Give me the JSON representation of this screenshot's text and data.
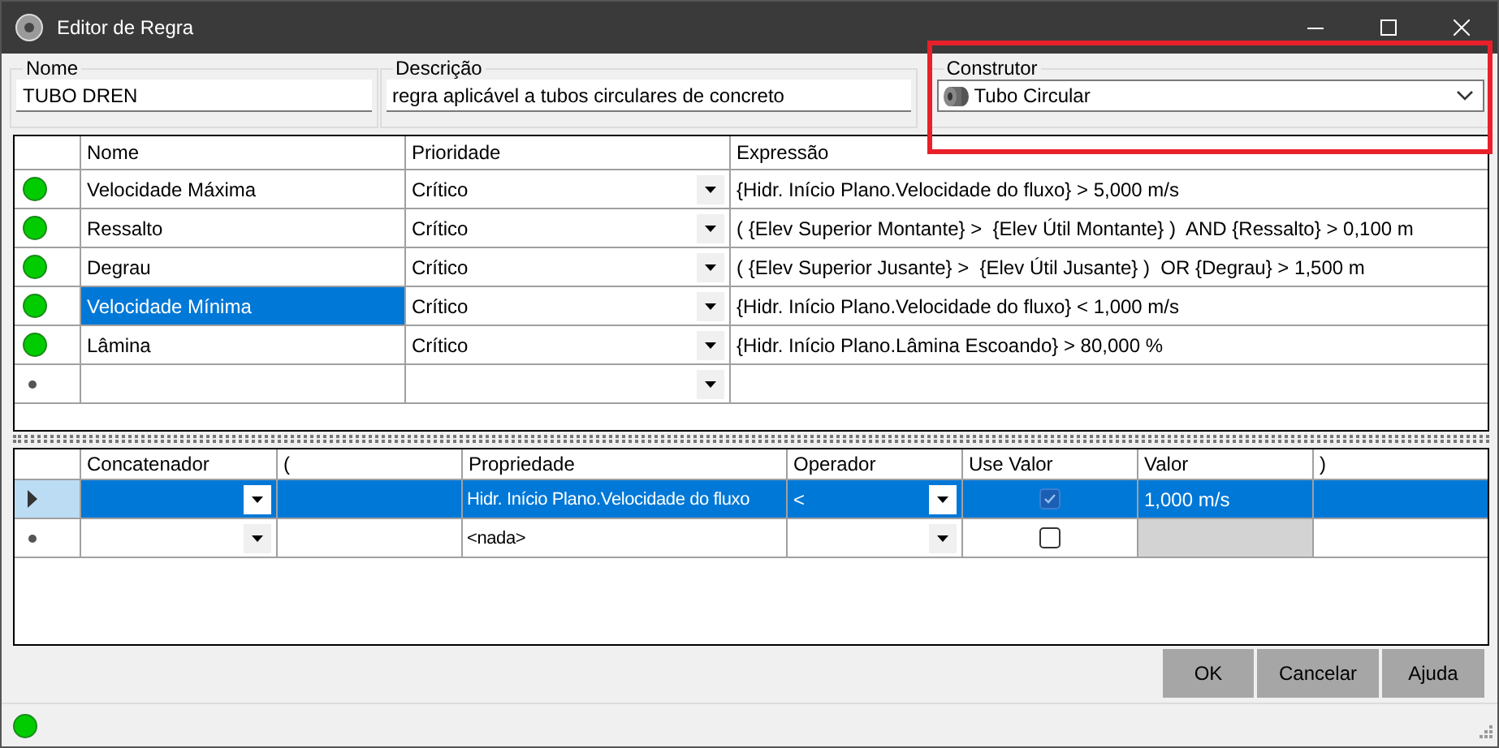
{
  "window": {
    "title": "Editor de Regra"
  },
  "fields": [
    {
      "label": "Nome",
      "value": "TUBO DREN"
    },
    {
      "label": "Descrição",
      "value": "regra aplicável a tubos circulares de concreto"
    }
  ],
  "builder": {
    "label": "Construtor",
    "value": "Tubo Circular"
  },
  "rules": {
    "columns": [
      "Nome",
      "Prioridade",
      "Expressão"
    ],
    "rows": [
      {
        "kind": "rule",
        "color": "#00cc00",
        "name": "Velocidade Máxima",
        "priority": "Crítico",
        "expression": "{Hidr. Início Plano.Velocidade do fluxo} > 5,000 m/s",
        "selected": false
      },
      {
        "kind": "rule",
        "color": "#00cc00",
        "name": "Ressalto",
        "priority": "Crítico",
        "expression": "( {Elev Superior Montante} >  {Elev Útil Montante} )  AND {Ressalto} > 0,100 m",
        "selected": false
      },
      {
        "kind": "rule",
        "color": "#00cc00",
        "name": "Degrau",
        "priority": "Crítico",
        "expression": "( {Elev Superior Jusante} >  {Elev Útil Jusante} )  OR {Degrau} > 1,500 m",
        "selected": false
      },
      {
        "kind": "rule",
        "color": "#00cc00",
        "name": "Velocidade Mínima",
        "priority": "Crítico",
        "expression": "{Hidr. Início Plano.Velocidade do fluxo} < 1,000 m/s",
        "selected": true
      },
      {
        "kind": "rule",
        "color": "#00cc00",
        "name": "Lâmina",
        "priority": "Crítico",
        "expression": "{Hidr. Início Plano.Lâmina Escoando} > 80,000 %",
        "selected": false
      },
      {
        "kind": "new",
        "selected": false
      }
    ]
  },
  "conditions": {
    "columns": [
      "Concatenador",
      "(",
      "Propriedade",
      "Operador",
      "Use Valor",
      "Valor",
      ")"
    ],
    "rows": [
      {
        "kind": "current",
        "property": "Hidr. Início Plano.Velocidade do fluxo",
        "operator": "<",
        "use_value": true,
        "value": "1,000 m/s",
        "value_disabled": false,
        "selected": true
      },
      {
        "kind": "new",
        "property": "<nada>",
        "use_value": false,
        "value_disabled": true,
        "selected": false
      }
    ]
  },
  "buttons": [
    "OK",
    "Cancelar",
    "Ajuda"
  ],
  "status_bar": {
    "color": "#00cc00"
  }
}
